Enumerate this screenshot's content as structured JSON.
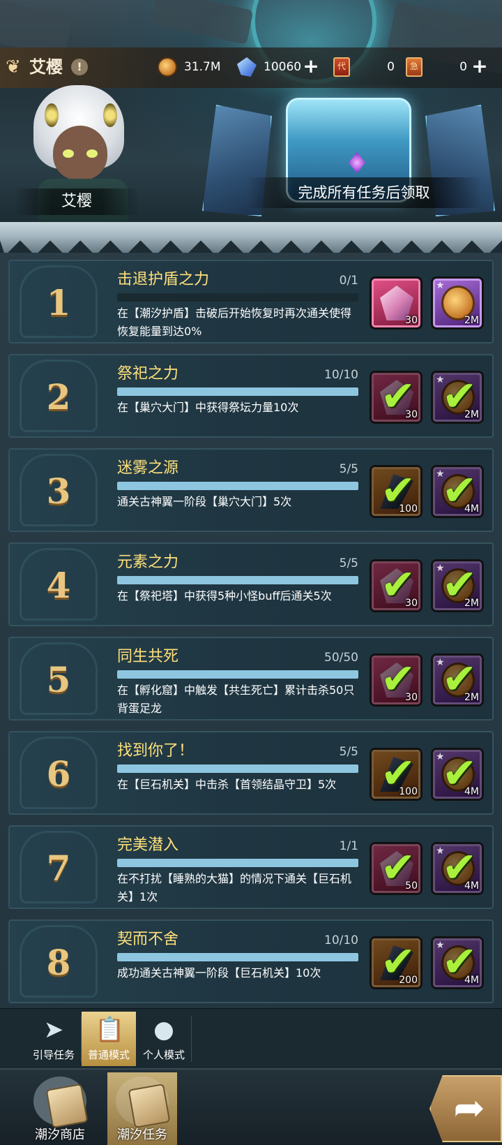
{
  "header": {
    "player_name": "艾樱",
    "alert_symbol": "!",
    "resources": [
      {
        "icon": "coin-icon",
        "value": "31.7M"
      },
      {
        "icon": "crystal-icon",
        "value": "10060"
      },
      {
        "icon": "ticket-red-icon",
        "value": "0"
      },
      {
        "icon": "ticket-orange-icon",
        "value": "0"
      }
    ],
    "plus_symbol": "+"
  },
  "hero": {
    "name": "艾樱"
  },
  "chest": {
    "label": "完成所有任务后领取"
  },
  "tasks": [
    {
      "num": "1",
      "title": "击退护盾之力",
      "count": "0/1",
      "progress": 0,
      "desc": "在【潮汐护盾】击破后开始恢复时再次通关使得恢复能量到达0%",
      "done": false,
      "rewards": [
        {
          "type": "pink-crystal",
          "qty": "30"
        },
        {
          "type": "coin",
          "qty": "2M"
        }
      ]
    },
    {
      "num": "2",
      "title": "祭祀之力",
      "count": "10/10",
      "progress": 1,
      "desc": "在【巢穴大门】中获得祭坛力量10次",
      "done": true,
      "rewards": [
        {
          "type": "pink-crystal",
          "qty": "30"
        },
        {
          "type": "coin",
          "qty": "2M"
        }
      ]
    },
    {
      "num": "3",
      "title": "迷雾之源",
      "count": "5/5",
      "progress": 1,
      "desc": "通关古神翼一阶段【巢穴大门】5次",
      "done": true,
      "rewards": [
        {
          "type": "dark-feather",
          "qty": "100"
        },
        {
          "type": "coin",
          "qty": "4M"
        }
      ]
    },
    {
      "num": "4",
      "title": "元素之力",
      "count": "5/5",
      "progress": 1,
      "desc": "在【祭祀塔】中获得5种小怪buff后通关5次",
      "done": true,
      "rewards": [
        {
          "type": "pink-crystal",
          "qty": "30"
        },
        {
          "type": "coin",
          "qty": "2M"
        }
      ]
    },
    {
      "num": "5",
      "title": "同生共死",
      "count": "50/50",
      "progress": 1,
      "desc": "在【孵化窟】中触发【共生死亡】累计击杀50只背蛋足龙",
      "done": true,
      "rewards": [
        {
          "type": "pink-crystal",
          "qty": "30"
        },
        {
          "type": "coin",
          "qty": "2M"
        }
      ]
    },
    {
      "num": "6",
      "title": "找到你了！",
      "count": "5/5",
      "progress": 1,
      "desc": "在【巨石机关】中击杀【首领结晶守卫】5次",
      "done": true,
      "rewards": [
        {
          "type": "dark-feather",
          "qty": "100"
        },
        {
          "type": "coin",
          "qty": "4M"
        }
      ]
    },
    {
      "num": "7",
      "title": "完美潜入",
      "count": "1/1",
      "progress": 1,
      "desc": "在不打扰【睡熟的大猫】的情况下通关【巨石机关】1次",
      "done": true,
      "rewards": [
        {
          "type": "pink-crystal",
          "qty": "50"
        },
        {
          "type": "coin",
          "qty": "4M"
        }
      ]
    },
    {
      "num": "8",
      "title": "契而不舍",
      "count": "10/10",
      "progress": 1,
      "desc": "成功通关古神翼一阶段【巨石机关】10次",
      "done": true,
      "rewards": [
        {
          "type": "dark-feather",
          "qty": "200"
        },
        {
          "type": "coin",
          "qty": "4M"
        }
      ]
    }
  ],
  "check_symbol": "✔",
  "mode_tabs": [
    {
      "label": "引导任务",
      "icon": "paper-plane-icon",
      "active": false
    },
    {
      "label": "普通模式",
      "icon": "clipboard-icon",
      "active": true
    },
    {
      "label": "个人模式",
      "icon": "person-icon",
      "active": false
    }
  ],
  "bottom_nav": [
    {
      "label": "潮汐商店",
      "icon": "scroll-shop-icon",
      "active": false
    },
    {
      "label": "潮汐任务",
      "icon": "scroll-quest-icon",
      "active": true
    }
  ],
  "go_button": {
    "icon": "arrow-right-icon"
  }
}
